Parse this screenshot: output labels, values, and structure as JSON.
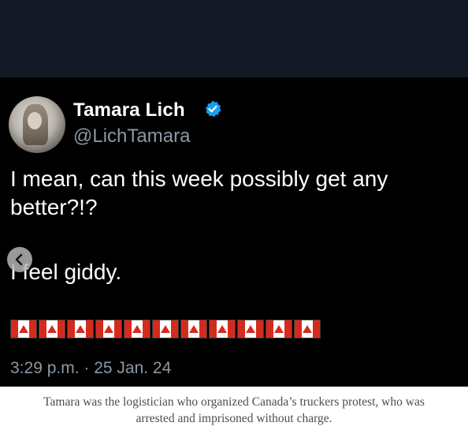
{
  "tweet": {
    "name": "Tamara Lich",
    "handle": "@LichTamara",
    "verified_icon": "verified-badge-icon",
    "text_line1": "I mean, can this week possibly get any better?!?",
    "text_line2": "I feel giddy.",
    "flags_count_icon": "canada-flag-icon",
    "timestamp": "3:29 p.m. · 25 Jan. 24"
  },
  "gallery": {
    "prev_icon": "chevron-left-icon"
  },
  "caption": {
    "line1": "Tamara was the logistician who organized Canada’s truckers protest, who was",
    "line2": "arrested and imprisoned without charge."
  },
  "colors": {
    "background": "#000000",
    "text": "#ffffff",
    "muted": "#8b98a5",
    "verified": "#1d9bf0",
    "flag_red": "#d52b1e"
  }
}
